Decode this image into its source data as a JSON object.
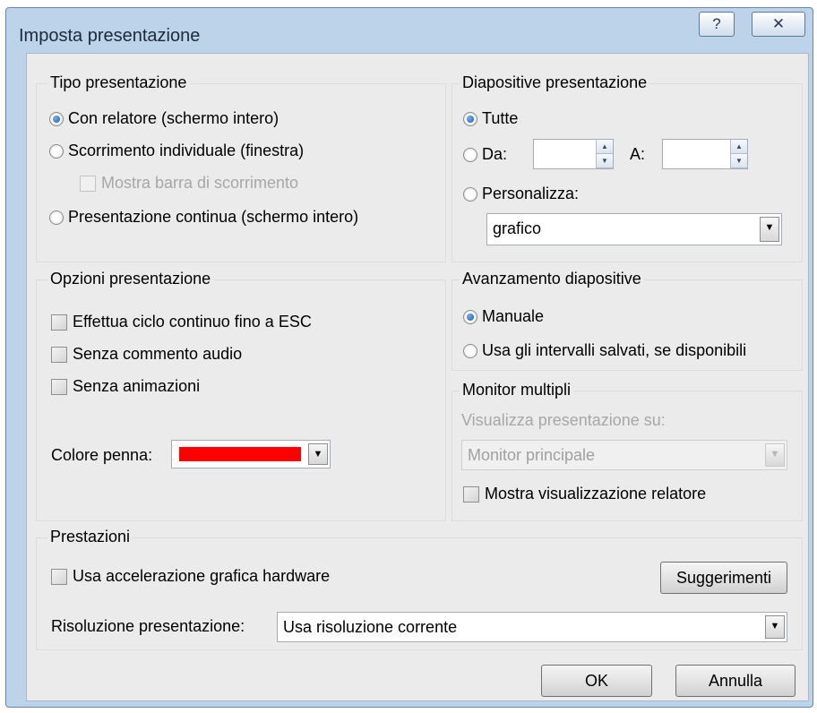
{
  "dialog": {
    "title": "Imposta presentazione",
    "help_button": "?",
    "close_button": "✕"
  },
  "tipo_presentazione": {
    "title": "Tipo presentazione",
    "options": [
      {
        "label": "Con relatore (schermo intero)",
        "checked": true
      },
      {
        "label": "Scorrimento individuale (finestra)",
        "checked": false
      },
      {
        "label": "Presentazione continua (schermo intero)",
        "checked": false
      }
    ],
    "scrollbar_checkbox": "Mostra barra di scorrimento"
  },
  "diapositive": {
    "title": "Diapositive presentazione",
    "all_label": "Tutte",
    "from_label": "Da:",
    "to_label": "A:",
    "from_value": "",
    "to_value": "",
    "custom_label": "Personalizza:",
    "custom_value": "grafico"
  },
  "opzioni": {
    "title": "Opzioni presentazione",
    "loop_label": "Effettua ciclo continuo fino a ESC",
    "no_audio_label": "Senza commento audio",
    "no_anim_label": "Senza animazioni",
    "pen_color_label": "Colore penna:",
    "pen_color": "#ff0000"
  },
  "avanzamento": {
    "title": "Avanzamento diapositive",
    "manual_label": "Manuale",
    "timings_label": "Usa gli intervalli salvati, se disponibili"
  },
  "monitor": {
    "title": "Monitor multipli",
    "show_on_label": "Visualizza presentazione su:",
    "monitor_value": "Monitor principale",
    "presenter_view_label": "Mostra visualizzazione relatore"
  },
  "prestazioni": {
    "title": "Prestazioni",
    "hw_accel_label": "Usa accelerazione grafica hardware",
    "tips_button": "Suggerimenti",
    "resolution_label": "Risoluzione presentazione:",
    "resolution_value": "Usa risoluzione corrente"
  },
  "footer": {
    "ok": "OK",
    "cancel": "Annulla"
  },
  "icons": {
    "dropdown_arrow": "▼",
    "spin_up": "▲",
    "spin_down": "▼"
  }
}
